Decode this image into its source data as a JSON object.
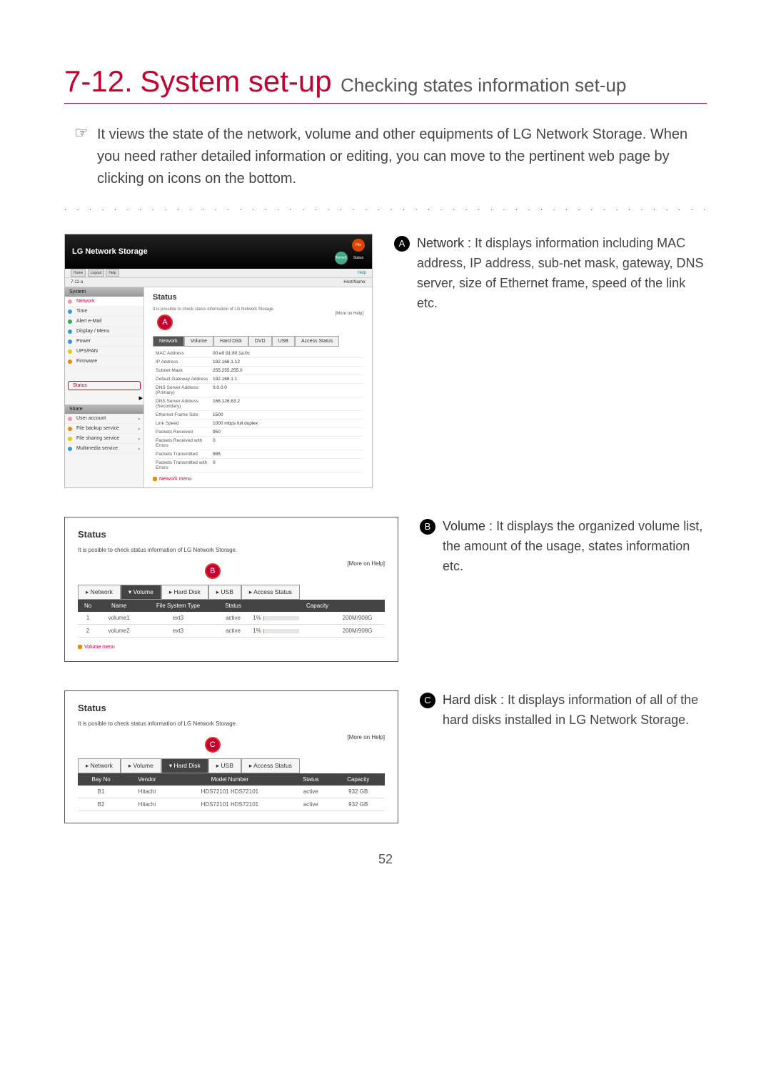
{
  "page_number": "52",
  "title": {
    "num": "7-12.",
    "main": "System set-up",
    "sub": "Checking states information set-up"
  },
  "intro": "It views the state of the network, volume and other equipments of LG Network Storage. When you need rather detailed information or editing, you can move to the pertinent web page by clicking on icons on the bottom.",
  "markers": {
    "a": "A",
    "b": "B",
    "c": "C"
  },
  "desc": {
    "a_title": "Network :",
    "a": "It displays information including MAC address, IP address, sub-net mask, gateway, DNS server, size of Ethernet frame, speed of the link etc.",
    "b_title": "Volume :",
    "b": "It displays the organized volume list, the amount of the usage, states information etc.",
    "c_title": "Hard disk :",
    "c": "It displays information of all of the hard disks installed in LG Network Storage."
  },
  "shot1": {
    "brand": "LG Network Storage",
    "top_icons": {
      "i1": "Torrent",
      "i2": "File Status"
    },
    "subtabs": [
      "Home",
      "Logout",
      "Help"
    ],
    "subinfo_left": "7-12-a",
    "subinfo_right_label": "Host/Name:",
    "help_btn": "Help",
    "sidebar": {
      "sections": [
        {
          "title": "System",
          "items": [
            {
              "label": "Network",
              "c": "d-pk"
            },
            {
              "label": "Time",
              "c": "d-bl"
            },
            {
              "label": "Alert e-Mail",
              "c": "d-gr"
            },
            {
              "label": "Display / Menu",
              "c": "d-bl"
            },
            {
              "label": "Power",
              "c": "d-bl"
            },
            {
              "label": "UPS/FAN",
              "c": "d-yl"
            },
            {
              "label": "Firmware",
              "c": "d-or"
            }
          ]
        },
        {
          "title": "Share",
          "items": [
            {
              "label": "User account",
              "c": "d-pk",
              "arr": "▸"
            },
            {
              "label": "File backup service",
              "c": "d-or",
              "arr": "▸"
            },
            {
              "label": "File sharing service",
              "c": "d-yl",
              "arr": "▸"
            },
            {
              "label": "Multimedia service",
              "c": "d-bl",
              "arr": "▸"
            }
          ]
        }
      ],
      "status_box": "Status"
    },
    "status": {
      "title": "Status",
      "subtext": "It is possible to check status information of LG Network Storage.",
      "more_help": "[More on Help]",
      "tabs": [
        "Network",
        "Volume",
        "Hard Disk",
        "DVD",
        "USB",
        "Access Status"
      ],
      "active_tab": 0,
      "kv": [
        {
          "k": "MAC Address",
          "v": "00:e0:91:80:1a:0c"
        },
        {
          "k": "IP Address",
          "v": "192.168.1.12"
        },
        {
          "k": "Subnet Mask",
          "v": "255.255.255.0"
        },
        {
          "k": "Default Gateway Address",
          "v": "192.168.1.1"
        },
        {
          "k": "DNS Server Address (Primary)",
          "v": "0.0.0.0"
        },
        {
          "k": "DNS Server Address (Secondary)",
          "v": "168.126.63.2"
        },
        {
          "k": "Ethernet Frame Size",
          "v": "1500"
        },
        {
          "k": "Link Speed",
          "v": "1000 mbps full duplex"
        },
        {
          "k": "Packets Received",
          "v": "950"
        },
        {
          "k": "Packets Received with Errors",
          "v": "0"
        },
        {
          "k": "Packets Transmitted",
          "v": "985"
        },
        {
          "k": "Packets Transmitted with Errors",
          "v": "0"
        }
      ],
      "menu_link": "Network menu"
    }
  },
  "shot2": {
    "title": "Status",
    "subtext": "It is posible to check status information of LG Network Storage.",
    "more_help": "[More on Help]",
    "tabs": [
      "Network",
      "Volume",
      "Hard Disk",
      "USB",
      "Access Status"
    ],
    "active_tab": 1,
    "thead": [
      "No",
      "Name",
      "File System Type",
      "Status",
      "Capacity"
    ],
    "rows": [
      {
        "no": "1",
        "name": "volume1",
        "fs": "ext3",
        "status": "active",
        "pct": "1%",
        "cap": "200M/908G"
      },
      {
        "no": "2",
        "name": "volume2",
        "fs": "ext3",
        "status": "active",
        "pct": "1%",
        "cap": "200M/908G"
      }
    ],
    "menu_link": "Volume menu"
  },
  "shot3": {
    "title": "Status",
    "subtext": "It is posible to check status information of LG Network Storage.",
    "more_help": "[More on Help]",
    "tabs": [
      "Network",
      "Volume",
      "Hard Disk",
      "USB",
      "Access Status"
    ],
    "active_tab": 2,
    "thead": [
      "Bay No",
      "Vendor",
      "Model Number",
      "Status",
      "Capacity"
    ],
    "rows": [
      {
        "bay": "B1",
        "vendor": "Hitachi",
        "model": "HDS72101 HDS72101",
        "status": "active",
        "cap": "932 GB"
      },
      {
        "bay": "B2",
        "vendor": "Hitachi",
        "model": "HDS72101 HDS72101",
        "status": "active",
        "cap": "932 GB"
      }
    ]
  }
}
